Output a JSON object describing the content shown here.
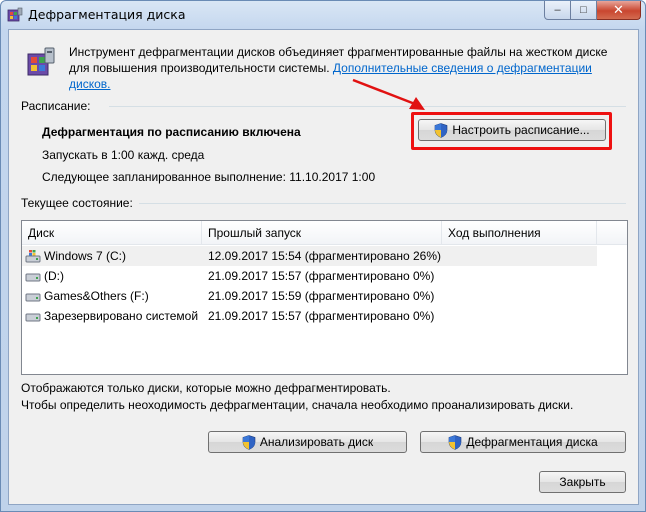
{
  "window": {
    "title": "Дефрагментация диска"
  },
  "intro": {
    "text": "Инструмент дефрагментации дисков объединяет фрагментированные файлы на жестком диске для повышения производительности системы.",
    "link": "Дополнительные сведения о дефрагментации дисков."
  },
  "schedule": {
    "label": "Расписание:",
    "status": "Дефрагментация по расписанию включена",
    "run": "Запускать в 1:00 кажд. среда",
    "next": "Следующее запланированное выполнение: 11.10.2017 1:00",
    "button": "Настроить расписание..."
  },
  "current": {
    "label": "Текущее состояние:",
    "columns": [
      "Диск",
      "Прошлый запуск",
      "Ход выполнения"
    ],
    "rows": [
      {
        "disk": "Windows 7 (C:)",
        "last": "12.09.2017 15:54 (фрагментировано 26%)",
        "icon": "windows-drive-icon"
      },
      {
        "disk": "(D:)",
        "last": "21.09.2017 15:57 (фрагментировано 0%)",
        "icon": "hard-drive-icon"
      },
      {
        "disk": "Games&Others (F:)",
        "last": "21.09.2017 15:59 (фрагментировано 0%)",
        "icon": "hard-drive-icon"
      },
      {
        "disk": "Зарезервировано системой",
        "last": "21.09.2017 15:57 (фрагментировано 0%)",
        "icon": "hard-drive-icon"
      }
    ]
  },
  "notes": {
    "line1": "Отображаются только диски, которые можно дефрагментировать.",
    "line2": "Чтобы определить неоходимость  дефрагментации, сначала необходимо проанализировать диски."
  },
  "buttons": {
    "analyze": "Анализировать диск",
    "defrag": "Дефрагментация диска",
    "close": "Закрыть"
  },
  "colors": {
    "link": "#0066cc",
    "highlight": "#e11111",
    "annotation_arrow": "#e11111"
  }
}
